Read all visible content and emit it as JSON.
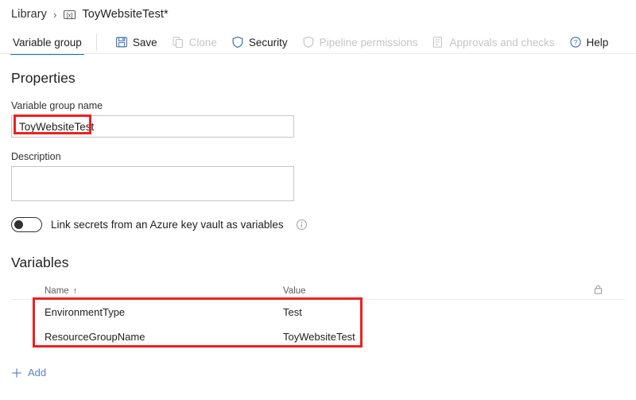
{
  "breadcrumb": {
    "root_label": "Library",
    "separator": "›",
    "icon": "variable-group-icon",
    "current_label": "ToyWebsiteTest*"
  },
  "commandbar": {
    "tab_label": "Variable group",
    "items": [
      {
        "label": "Save",
        "icon": "save-icon",
        "disabled": false
      },
      {
        "label": "Clone",
        "icon": "clone-icon",
        "disabled": true
      },
      {
        "label": "Security",
        "icon": "shield-icon",
        "disabled": false
      },
      {
        "label": "Pipeline permissions",
        "icon": "shield-outline-icon",
        "disabled": true
      },
      {
        "label": "Approvals and checks",
        "icon": "checklist-icon",
        "disabled": true
      },
      {
        "label": "Help",
        "icon": "help-circle-icon",
        "disabled": false
      }
    ]
  },
  "properties": {
    "title": "Properties",
    "name_label": "Variable group name",
    "name_value": "ToyWebsiteTest",
    "name_placeholder": "",
    "description_label": "Description",
    "description_value": "",
    "description_placeholder": "",
    "toggle_label": "Link secrets from an Azure key vault as variables",
    "toggle_state": "off",
    "info_icon": "info-circle-icon"
  },
  "variables": {
    "title": "Variables",
    "columns": [
      "Name",
      "Value"
    ],
    "sort_column": "Name",
    "sort_direction": "↑",
    "lock_icon": "lock-icon",
    "rows": [
      {
        "name": "EnvironmentType",
        "value": "Test"
      },
      {
        "name": "ResourceGroupName",
        "value": "ToyWebsiteTest"
      }
    ],
    "add_label": "Add",
    "add_icon": "plus-icon"
  },
  "annotations": {
    "highlight_color": "#ef2020",
    "boxes": [
      "variable-group-name-value",
      "variables-table-rows"
    ]
  },
  "colors": {
    "accent": "#0078d4",
    "link": "#5b82c4",
    "text": "#201f1e",
    "muted": "#605e5c",
    "disabled": "#c8c6c4",
    "border": "#c8c6c4",
    "divider": "#edebe9"
  }
}
